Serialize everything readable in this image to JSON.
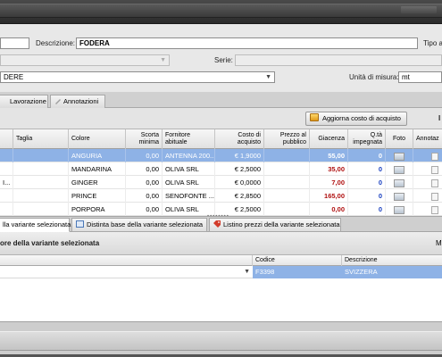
{
  "form": {
    "descrizione_label": "Descrizione:",
    "descrizione_value": "FODERA",
    "tipo_label": "Tipo ar",
    "serie_label": "Serie:",
    "material_value": "DERE",
    "unita_label": "Unità di misura:",
    "unita_value": "mt"
  },
  "top_tabs": [
    {
      "label": "Lavorazione"
    },
    {
      "label": "Annotazioni"
    }
  ],
  "toolbar": {
    "update_cost_label": "Aggiorna costo di acquisto"
  },
  "grid": {
    "columns": {
      "taglia": "Taglia",
      "colore": "Colore",
      "scorta": "Scorta minima",
      "fornitore": "Fornitore abituale",
      "costo": "Costo di acquisto",
      "prezzo": "Prezzo al pubblico",
      "giacenza": "Giacenza",
      "impegnata": "Q.tà impegnata",
      "foto": "Foto",
      "annotazioni": "Annotaz"
    },
    "rows": [
      {
        "lead": "",
        "colore": "ANGURIA",
        "scorta": "0,00",
        "fornitore": "ANTENNA 200...",
        "costo": "€ 1,9000",
        "giacenza": "55,00",
        "impegnata": "0"
      },
      {
        "lead": "",
        "colore": "MANDARINA",
        "scorta": "0,00",
        "fornitore": "OLIVA SRL",
        "costo": "€ 2,5000",
        "giacenza": "35,00",
        "impegnata": "0"
      },
      {
        "lead": "I...",
        "colore": "GINGER",
        "scorta": "0,00",
        "fornitore": "OLIVA SRL",
        "costo": "€ 0,0000",
        "giacenza": "7,00",
        "impegnata": "0"
      },
      {
        "lead": "",
        "colore": "PRINCE",
        "scorta": "0,00",
        "fornitore": "SENOFONTE ...",
        "costo": "€ 2,8500",
        "giacenza": "165,00",
        "impegnata": "0"
      },
      {
        "lead": "",
        "colore": "PORPORA",
        "scorta": "0,00",
        "fornitore": "OLIVA SRL",
        "costo": "€ 2,5000",
        "giacenza": "0,00",
        "impegnata": "0"
      }
    ]
  },
  "bottom_tabs": [
    {
      "label": "lla variante selezionata"
    },
    {
      "label": "Distinta base della variante selezionata"
    },
    {
      "label": "Listino prezzi della variante selezionata"
    }
  ],
  "detail": {
    "title": "ore della variante selezionata",
    "extra": "M",
    "col_codice": "Codice",
    "col_descrizione": "Descrizione",
    "row": {
      "codice": "F3398",
      "descrizione": "SVIZZERA"
    }
  },
  "colors": {
    "selection": "#8eb2e6",
    "detail_selection": "#8eb2e6",
    "giacenza_red": "#b01010",
    "impegnata_blue": "#1a40c0"
  }
}
